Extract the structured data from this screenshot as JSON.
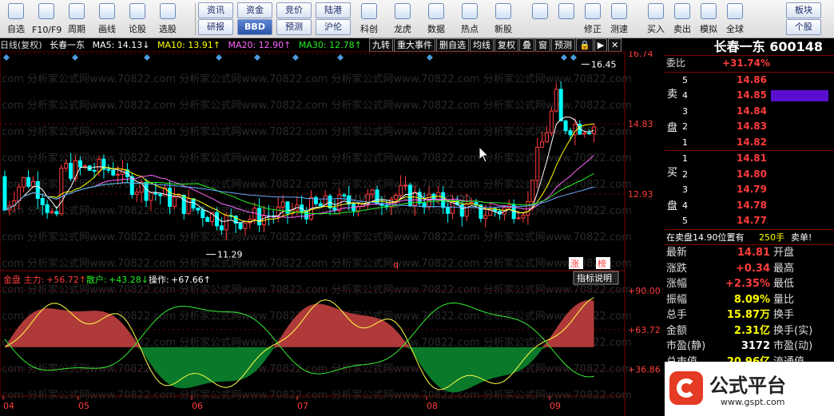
{
  "toolbar": {
    "buttons": [
      {
        "label": "自选",
        "icon": "star-icon"
      },
      {
        "label": "F10/F9",
        "icon": "info-icon"
      },
      {
        "label": "周期",
        "icon": "clock-icon"
      },
      {
        "label": "画线",
        "icon": "pencil-icon"
      },
      {
        "label": "论股",
        "icon": "chat-icon"
      },
      {
        "label": "选股",
        "icon": "filter-icon"
      }
    ],
    "text_buttons": [
      "资讯",
      "资金",
      "竞价",
      "陆港",
      "研报",
      "BBD",
      "预测",
      "沪伦"
    ],
    "buttons2": [
      {
        "label": "科创",
        "icon": "chart-icon"
      },
      {
        "label": "龙虎",
        "icon": "dragon-icon"
      },
      {
        "label": "数据",
        "icon": "pe-icon"
      },
      {
        "label": "热点",
        "icon": "fire-icon"
      },
      {
        "label": "新股",
        "icon": "ipo-icon"
      }
    ],
    "buttons3": [
      {
        "label": "",
        "icon": "grid-icon"
      },
      {
        "label": "",
        "icon": "back-arrow-icon"
      },
      {
        "label": "修正",
        "icon": "up-arrow-icon"
      },
      {
        "label": "测速",
        "icon": "speed-icon"
      },
      {
        "label": "买入",
        "icon": "buy-icon"
      },
      {
        "label": "卖出",
        "icon": "sell-icon"
      },
      {
        "label": "模拟",
        "icon": "hammer-icon"
      },
      {
        "label": "全球",
        "icon": "globe-icon"
      }
    ],
    "right_buttons": [
      "板块",
      "个股"
    ],
    "buy_char": "买",
    "sell_char": "卖"
  },
  "status": {
    "mode": "日线(复权)",
    "name": "长春一东",
    "ma5": "MA5: 14.13↓",
    "ma10": "MA10: 13.91↑",
    "ma20": "MA20: 12.90↑",
    "ma30": "MA30: 12.78↑"
  },
  "tabs": [
    "九转",
    "重大事件",
    "删自选",
    "均线",
    "复权",
    "叠",
    "窗",
    "预测"
  ],
  "main_chart": {
    "y_labels": [
      "16.74",
      "14.83",
      "12.93"
    ],
    "high_label": "16.45",
    "low_label": "11.29",
    "x_labels": [
      "04",
      "05",
      "06",
      "07",
      "08",
      "09"
    ],
    "markers": [
      "q",
      "涨",
      "榜"
    ],
    "watermark": "www.gspt.com",
    "watermark_rows": [
      ".com 分析家公式网www.70822.com 分析家公式网www.70822.com 分析家公式网www.70822.com 分析家公式网www.70822.com",
      ".com 分析家公式网www.70822.com 分析家公式网www.70822.com 分析家公式网www.70822.com 分析家公式网www.70822.com",
      ".com 分析家公式网www.70822.com 分析家公式网www.70822.com 分析家公式网www.70822.com 分析家公式网www.70822.com",
      ".com 分析家公式网www.70822.com 分析家公式网www.70822.com 分析家公式网www.70822.com 分析家公式网www.70822.com",
      ".com 分析家公式网www.70822.com 分析家公式网www.70822.com 分析家公式网www.70822.com 分析家公式网www.70822.com",
      ".com 分析家公式网www.70822.com 分析家公式网www.70822.com 分析家公式网www.70822.com 分析家公式网www.70822.com",
      ".com 分析家公式网www.70822.com 分析家公式网www.70822.com 分析家公式网www.70822.com 分析家公式网www.70822.com",
      ".com 分析家公式网www.70822.com 分析家公式网www.70822.com 分析家公式网www.70822.com 分析家公式网www.70822.com",
      ".com 分析家公式网www.70822.com 分析家公式网www.70822.com 分析家公式网www.70822.com 分析家公式网www.70822.com",
      ".com 分析家公式网www.70822.com 分析家公式网www.70822.com 分析家公式网www.70822.com 分析家公式网www.70822.com",
      ".com 分析家公式网www.70822.com 分析家公式网www.70822.com 分析家公式网www.70822.com 分析家公式网www.70822.com",
      ".com 分析家公式网www.70822.com 分析家公式网www.70822.com 分析家公式网www.70822.com 分析家公式网www.70822.com",
      ".com 分析家公式网www.70822.com 分析家公式网www.70822.com 分析家公式网www.70822.com 分析家公式网www.70822.com"
    ]
  },
  "sub_chart": {
    "title": "金盘 主力:",
    "main_val": "+56.72↑",
    "retail_label": "散户:",
    "retail_val": "+43.28↓",
    "op_label": "操作:",
    "op_val": "+67.66↑",
    "indicator_btn": "指标说明",
    "y_labels": [
      "+90.00",
      "+63.72",
      "+36.86"
    ]
  },
  "right_panel": {
    "title": "长春一东 600148",
    "weibi_label": "委比",
    "weibi_val": "+31.74%",
    "sell_side": "卖盘",
    "buy_side": "买盘",
    "asks": [
      {
        "idx": "5",
        "price": "14.86"
      },
      {
        "idx": "4",
        "price": "14.85"
      },
      {
        "idx": "3",
        "price": "14.84"
      },
      {
        "idx": "2",
        "price": "14.83"
      },
      {
        "idx": "1",
        "price": "14.82"
      }
    ],
    "bids": [
      {
        "idx": "1",
        "price": "14.81"
      },
      {
        "idx": "2",
        "price": "14.80"
      },
      {
        "idx": "3",
        "price": "14.79"
      },
      {
        "idx": "4",
        "price": "14.78"
      },
      {
        "idx": "5",
        "price": "14.77"
      }
    ],
    "notice": {
      "text": "在卖盘14.90位置有",
      "vol": "250手",
      "tail": "卖单!"
    },
    "stats": [
      {
        "l": "最新",
        "v": "14.81",
        "r": "开盘"
      },
      {
        "l": "涨跌",
        "v": "+0.34",
        "r": "最高"
      },
      {
        "l": "涨幅",
        "v": "+2.35%",
        "r": "最低"
      },
      {
        "l": "振幅",
        "v": "8.09%",
        "r": "量比"
      },
      {
        "l": "总手",
        "v": "15.87万",
        "r": "换手"
      },
      {
        "l": "金额",
        "v": "2.31亿",
        "r": "换手(实)"
      },
      {
        "l": "市盈(静)",
        "v": "3172",
        "r": "市盈(动)"
      },
      {
        "l": "总市值",
        "v": "20.96亿",
        "r": "流通值"
      }
    ]
  },
  "logo": {
    "text": "公式平台",
    "url": "www.gspt.com"
  },
  "chart_data": {
    "type": "candlestick",
    "y_ticks": [
      16.74,
      14.83,
      12.93
    ],
    "x_ticks": [
      "04",
      "05",
      "06",
      "07",
      "08",
      "09"
    ],
    "high": 16.45,
    "low": 11.29,
    "subchart_ticks": [
      90.0,
      63.72,
      36.86
    ]
  },
  "colors": {
    "up": "#ff3c3c",
    "down": "#00ffff",
    "grid": "#800000",
    "accent": "#ff3c3c"
  }
}
